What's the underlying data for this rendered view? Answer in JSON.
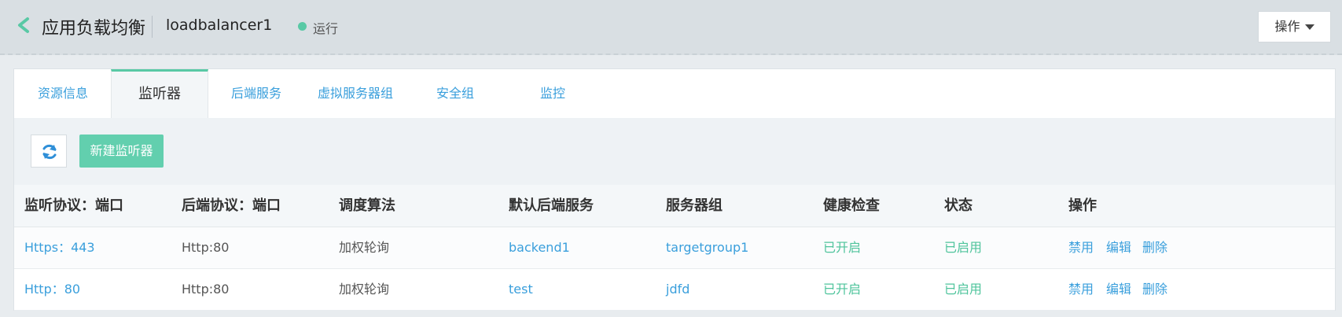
{
  "header": {
    "title": "应用负载均衡",
    "lb_name": "loadbalancer1",
    "status": "运行",
    "status_color": "#59c9a5",
    "ops_label": "操作",
    "back_icon": "chevron-left-icon"
  },
  "tabs": [
    {
      "label": "资源信息",
      "active": false
    },
    {
      "label": "监听器",
      "active": true
    },
    {
      "label": "后端服务",
      "active": false
    },
    {
      "label": "虚拟服务器组",
      "active": false
    },
    {
      "label": "安全组",
      "active": false
    },
    {
      "label": "监控",
      "active": false
    }
  ],
  "toolbar": {
    "refresh_icon": "refresh-icon",
    "create_label": "新建监听器"
  },
  "table": {
    "columns": [
      "监听协议：端口",
      "后端协议：端口",
      "调度算法",
      "默认后端服务",
      "服务器组",
      "健康检查",
      "状态",
      "操作"
    ],
    "rows": [
      {
        "listener": "Https：443",
        "backend_protocol": "Http:80",
        "algorithm": "加权轮询",
        "default_backend": "backend1",
        "server_group": "targetgroup1",
        "health_check": "已开启",
        "status": "已启用",
        "actions": [
          "禁用",
          "编辑",
          "删除"
        ]
      },
      {
        "listener": "Http：80",
        "backend_protocol": "Http:80",
        "algorithm": "加权轮询",
        "default_backend": "test",
        "server_group": "jdfd",
        "health_check": "已开启",
        "status": "已启用",
        "actions": [
          "禁用",
          "编辑",
          "删除"
        ]
      }
    ]
  },
  "colors": {
    "accent": "#59c9a5",
    "link": "#3a9fdc"
  }
}
